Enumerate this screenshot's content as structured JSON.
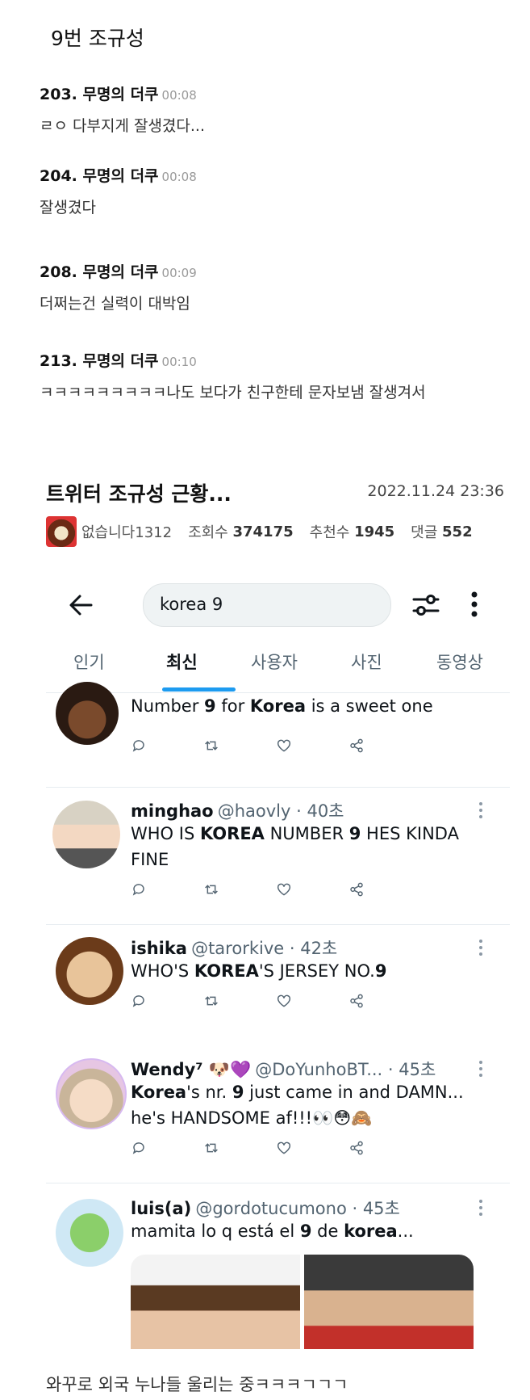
{
  "header_title": "9번 조규성",
  "comments": [
    {
      "num": "203.",
      "author": "무명의 더쿠",
      "time": "00:08",
      "text": "ㄹㅇ 다부지게 잘생겼다..."
    },
    {
      "num": "204.",
      "author": "무명의 더쿠",
      "time": "00:08",
      "text": "잘생겼다"
    },
    {
      "num": "208.",
      "author": "무명의 더쿠",
      "time": "00:09",
      "text": "더쩌는건 실력이 대박임"
    },
    {
      "num": "213.",
      "author": "무명의 더쿠",
      "time": "00:10",
      "text": "ㅋㅋㅋㅋㅋㅋㅋㅋㅋ나도 보다가 친구한테 문자보냄 잘생겨서"
    }
  ],
  "post": {
    "title": "트위터 조규성 근황...",
    "date": "2022.11.24 23:36",
    "author": "없습니다1312",
    "views_label": "조회수",
    "views": "374175",
    "recommend_label": "추천수",
    "recommend": "1945",
    "comments_label": "댓글",
    "comments_count": "552"
  },
  "twitter": {
    "search_value": "korea 9",
    "tabs": [
      "인기",
      "최신",
      "사용자",
      "사진",
      "동영상"
    ],
    "active_tab": "최신",
    "tweets": [
      {
        "name": "",
        "handle": "",
        "text_parts": [
          "Number ",
          "9",
          " for ",
          "Korea",
          " is a sweet one"
        ]
      },
      {
        "name": "minghao",
        "handle": "@haovly · 40초",
        "text_parts": [
          "WHO IS ",
          "KOREA",
          " NUMBER ",
          "9",
          " HES KINDA FINE"
        ]
      },
      {
        "name": "ishika",
        "handle": "@tarorkive · 42초",
        "text_parts": [
          "WHO'S ",
          "KOREA",
          "'S JERSEY NO.",
          "9",
          ""
        ]
      },
      {
        "name": "Wendy⁷ 🐶💜",
        "handle": "@DoYunhoBT...  · 45초",
        "text_parts": [
          "Korea",
          "'s nr. ",
          "9",
          " just came in and DAMN... he's HANDSOME af!!!👀😳🙈",
          ""
        ]
      },
      {
        "name": "luis(a)",
        "handle": "@gordotucumono · 45초",
        "text_parts": [
          "mamita lo q está el ",
          "9",
          " de ",
          "korea",
          "..."
        ]
      }
    ]
  },
  "caption": "와꾸로 외국 누나들 울리는 중ㅋㅋㅋㄱㄱㄱ",
  "colors": {
    "accent": "#1d9bf0",
    "text": "#0f1419",
    "muted": "#536471"
  }
}
